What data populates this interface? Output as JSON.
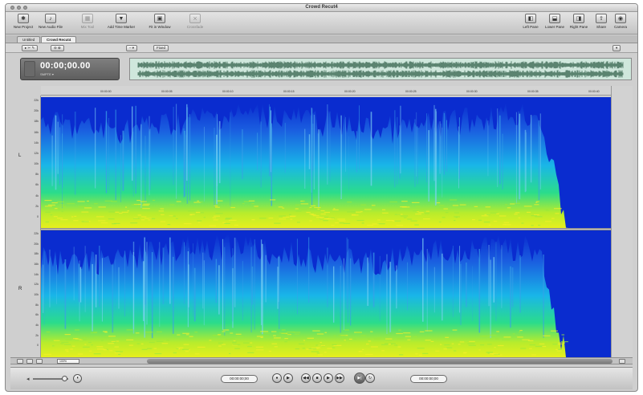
{
  "window": {
    "title": "Crowd Recut4"
  },
  "toolbar": {
    "left": [
      {
        "label": "New Project",
        "icon": "new-project-icon",
        "glyph": "✱",
        "enabled": true
      },
      {
        "label": "New Audio File",
        "icon": "new-audio-file-icon",
        "glyph": "♪",
        "enabled": true
      },
      {
        "label": "Mix Tool",
        "icon": "mix-tool-icon",
        "glyph": "▦",
        "enabled": false
      },
      {
        "label": "Add Time Marker",
        "icon": "time-marker-icon",
        "glyph": "▼",
        "enabled": true
      },
      {
        "label": "Fit in Window",
        "icon": "fit-window-icon",
        "glyph": "▣",
        "enabled": true
      },
      {
        "label": "Crossfade",
        "icon": "crossfade-icon",
        "glyph": "⨯",
        "enabled": false
      }
    ],
    "right": [
      {
        "label": "Left Pane",
        "icon": "left-pane-icon",
        "glyph": "◧"
      },
      {
        "label": "Lower Pane",
        "icon": "lower-pane-icon",
        "glyph": "⬓"
      },
      {
        "label": "Right Pane",
        "icon": "right-pane-icon",
        "glyph": "◨"
      },
      {
        "label": "Share",
        "icon": "share-icon",
        "glyph": "⇪"
      },
      {
        "label": "Camera",
        "icon": "camera-icon",
        "glyph": "◉"
      }
    ]
  },
  "tabs": [
    {
      "label": "Untitled",
      "active": false
    },
    {
      "label": "Crowd Recut4",
      "active": true
    }
  ],
  "subbar": {
    "tools_label": "▸ ✂ ✎",
    "zoom_label": "⊖ ⊕",
    "menu_label": "– ▾",
    "view_label": "Fixed",
    "right_label": "▾"
  },
  "timecode": {
    "value": "00:00;00.00",
    "sub": "SMPTE ▾"
  },
  "ruler": [
    "00:00:00",
    "00:00:05",
    "00:00:10",
    "00:00:15",
    "00:00:20",
    "00:00:25",
    "00:00:30",
    "00:00:35",
    "00:00:40"
  ],
  "channels": [
    {
      "label": "L"
    },
    {
      "label": "R"
    }
  ],
  "freq_labels": [
    "22k",
    "20k",
    "18k",
    "16k",
    "14k",
    "12k",
    "10k",
    "8k",
    "6k",
    "4k",
    "2k",
    "0"
  ],
  "scroll": {
    "zoom_value": "100%"
  },
  "transport": {
    "start_tc": "00:00:00;00",
    "end_tc": "00:00:00;00",
    "buttons": [
      {
        "glyph": "●",
        "name": "record-button-icon"
      },
      {
        "glyph": "▶",
        "name": "play-from-start-icon"
      },
      {
        "glyph": "◀◀",
        "name": "rewind-icon"
      },
      {
        "glyph": "■",
        "name": "stop-icon"
      },
      {
        "glyph": "▶",
        "name": "play-icon"
      },
      {
        "glyph": "▶▶",
        "name": "fast-forward-icon"
      },
      {
        "glyph": "▶|",
        "name": "go-to-end-icon"
      },
      {
        "glyph": "↻",
        "name": "loop-icon"
      }
    ]
  },
  "colors": {
    "spec_low": "#0a2ccf",
    "spec_mid": "#19b6e8",
    "spec_high": "#2bdc8b",
    "spec_peak": "#e6ef1e"
  }
}
